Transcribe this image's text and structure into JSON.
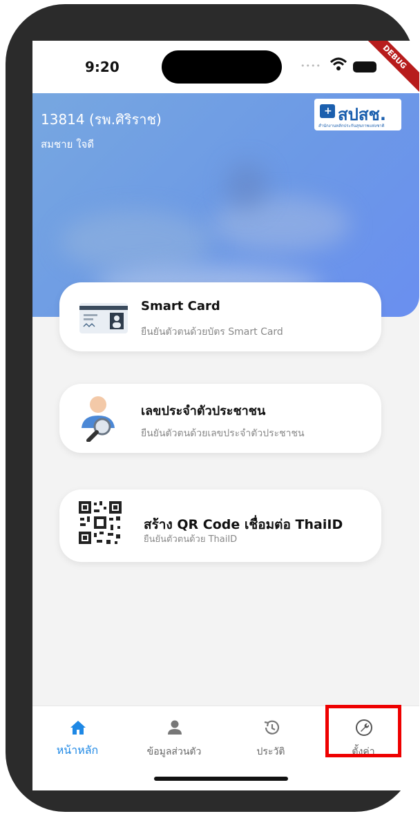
{
  "status_bar": {
    "time": "9:20",
    "debug_banner": "DEBUG"
  },
  "header": {
    "hospital": "13814 (รพ.ศิริราช)",
    "user_name": "สมชาย ใจดี",
    "logo_text": "สปสช.",
    "logo_subtext": "สำนักงานหลักประกันสุขภาพแห่งชาติ"
  },
  "cards": [
    {
      "icon": "smart-card-icon",
      "title": "Smart Card",
      "subtitle": "ยืนยันตัวตนด้วยบัตร Smart Card"
    },
    {
      "icon": "person-search-icon",
      "title": "เลขประจำตัวประชาชน",
      "subtitle": "ยืนยันตัวตนด้วยเลขประจำตัวประชาชน"
    },
    {
      "icon": "qr-code-icon",
      "title": "สร้าง QR Code เชื่อมต่อ ThaiID",
      "subtitle": "ยืนยันตัวตนด้วย ThaiID"
    }
  ],
  "nav": [
    {
      "icon": "home-icon",
      "label": "หน้าหลัก",
      "active": true
    },
    {
      "icon": "person-icon",
      "label": "ข้อมูลส่วนตัว",
      "active": false
    },
    {
      "icon": "history-icon",
      "label": "ประวัติ",
      "active": false
    },
    {
      "icon": "wrench-icon",
      "label": "ตั้งค่า",
      "active": false
    }
  ],
  "colors": {
    "accent": "#1e88e5",
    "header": "#6c99e6",
    "highlight": "#ee0000"
  }
}
